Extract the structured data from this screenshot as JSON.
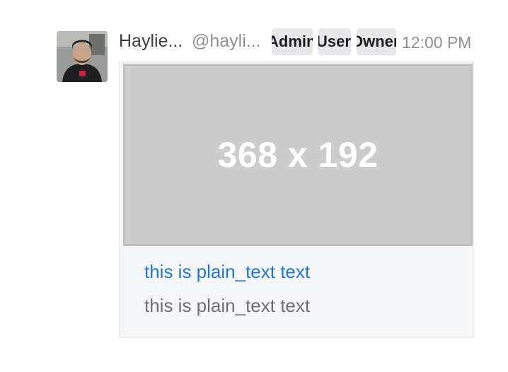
{
  "post": {
    "display_name": "Haylie...",
    "username": "@hayli...",
    "badges": [
      {
        "label": "Admin"
      },
      {
        "label": "User"
      },
      {
        "label": "Owner"
      }
    ],
    "time": "12:00 PM"
  },
  "attachment": {
    "thumbnail_label": "368 x 192",
    "title": "this is plain_text text",
    "text": "this is plain_text text"
  },
  "colors": {
    "link": "#2275d7",
    "thumbnail_bg": "#cccccc",
    "badge_bg": "#e5e7ea",
    "attachment_bg": "#f5f6f8"
  },
  "icons": {
    "avatar": "user-photo-avatar"
  }
}
